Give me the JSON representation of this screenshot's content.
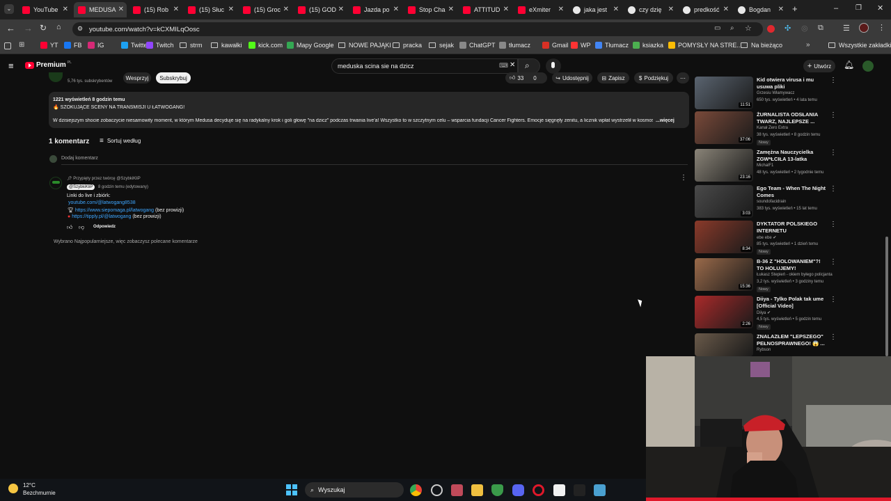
{
  "browser": {
    "tabs": [
      {
        "label": "YouTube"
      },
      {
        "label": "MEDUSA"
      },
      {
        "label": "(15) Rob"
      },
      {
        "label": "(15) Słuc"
      },
      {
        "label": "(15) Groc"
      },
      {
        "label": "(15) GOD"
      },
      {
        "label": "Jazda po"
      },
      {
        "label": "Stop Cha"
      },
      {
        "label": "ATTITUD"
      },
      {
        "label": "eXmiter"
      },
      {
        "label": "jaka jest"
      },
      {
        "label": "czy dzię"
      },
      {
        "label": "predkość"
      },
      {
        "label": "Bogdan"
      }
    ],
    "new_tab": "+",
    "url": "youtube.com/watch?v=kCXMILqOosc",
    "bookmarks": [
      {
        "label": "YT"
      },
      {
        "label": "FB"
      },
      {
        "label": "IG"
      },
      {
        "label": "Twitter"
      },
      {
        "label": "Twitch"
      },
      {
        "label": "strm"
      },
      {
        "label": "kawałki"
      },
      {
        "label": "kick.com"
      },
      {
        "label": "Mapy Google"
      },
      {
        "label": "NOWE PAJĄKI"
      },
      {
        "label": "pracka"
      },
      {
        "label": "sejak"
      },
      {
        "label": "ChatGPT"
      },
      {
        "label": "tłumacz"
      },
      {
        "label": "Gmail"
      },
      {
        "label": "WP"
      },
      {
        "label": "Tłumacz"
      },
      {
        "label": "ksiazka"
      },
      {
        "label": "POMYSŁY NA STRE..."
      },
      {
        "label": "Na bieżąco"
      }
    ],
    "all_bookmarks": "Wszystkie zakładki"
  },
  "yt_header": {
    "logo": "Premium",
    "logo_sup": "PL",
    "search_value": "meduska scina sie na dzicz",
    "create": "Utwórz"
  },
  "channel": {
    "subs": "5,76 tys. subskrybentów",
    "support": "Wesprzyj",
    "subscribe": "Subskrybuj",
    "likes": "33",
    "dislikes": "0",
    "share": "Udostępnij",
    "save": "Zapisz",
    "thanks": "Podziękuj"
  },
  "description": {
    "stats": "1221 wyświetleń  8 godzin temu",
    "headline": "🔥 SZOKUJĄCE SCENY NA TRANSMISJI U ŁATWOGANG!",
    "text": "W dzisiejszym shocie zobaczycie niesamowity moment, w którym Medusa decyduje się na radykalny krok i goli głowę \"na dzicz\" podczas trwania live'a! Wszystko to w szczytnym celu – wsparcia fundacji Cancer Fighters. Emocje sięgnęły zenitu, a licznik wpłat wystrzelił w kosmos!",
    "more": "...więcej"
  },
  "comments": {
    "count": "1 komentarz",
    "sort": "Sortuj według",
    "add": "Dodaj komentarz",
    "pinned": "Przypięty przez twórcę @SzybkiKliP",
    "author": "@SzybkiKliP",
    "time": "8 godzin temu (edytowany)",
    "line1": "Linki do live i zbiórk:",
    "link1": "youtube.com/@latwogang8538",
    "link2": "https://www.siepomaga.pl/latwogang",
    "link2_suffix": "(bez prowizji)",
    "link3": "https://tipply.pl/@latwogang",
    "link3_suffix": "(bez prowizji)",
    "reply": "Odpowiedz",
    "footer": "Wybrano Najpopularniejsze, więc zobaczysz polecane komentarze"
  },
  "sidebar": {
    "videos": [
      {
        "title": "Kid otwiera virusa i mu usuwa pliki",
        "channel": "Grzesiu Włamywacz",
        "meta": "650 tys. wyświetleń • 4 lata temu",
        "duration": "11:51",
        "new": "",
        "color": "#5a6470"
      },
      {
        "title": "ŻURNALISTA ODSŁANIA TWARZ, NAJLEPSZE ...",
        "channel": "Kanał Zero Extra",
        "meta": "38 tys. wyświetleń • 8 godzin temu",
        "duration": "37:06",
        "new": "Nowy",
        "color": "#7a4a3a"
      },
      {
        "title": "Zamężna Nauczycielka ZGW*ŁCIŁA 13-latka",
        "channel": "MichalF1",
        "meta": "48 tys. wyświetleń • 2 tygodnie temu",
        "duration": "23:16",
        "new": "",
        "color": "#8a8478"
      },
      {
        "title": "Ego Team - When The Night Comes",
        "channel": "soundofacidrain",
        "meta": "383 tys. wyświetleń • 15 lat temu",
        "duration": "3:03",
        "new": "",
        "color": "#4a4a4a"
      },
      {
        "title": "DYKTATOR POLSKIEGO INTERNETU",
        "channel": "ebe ebe ✔",
        "meta": "85 tys. wyświetleń • 1 dzień temu",
        "duration": "8:34",
        "new": "Nowy",
        "color": "#8a3a2a"
      },
      {
        "title": "B-36 Z \"HOLOWANIEM\"?! TO HOLUJEMY!",
        "channel": "Łukasz Stepień - okiem byłego policjanta",
        "meta": "3,2 tys. wyświetleń • 3 godziny temu",
        "duration": "15:36",
        "new": "Nowy",
        "color": "#9a6a4a"
      },
      {
        "title": "Diiya - Tylko Polak tak ume [Official Video]",
        "channel": "Diiya ✔",
        "meta": "4,5 tys. wyświetleń • 5 godzin temu",
        "duration": "2:26",
        "new": "Nowy",
        "color": "#aa2a2a"
      },
      {
        "title": "ZNALAZŁEM \"LEPSZEGO\" PEŁNOSPRAWNEGO! 😱 ...",
        "channel": "Rybson",
        "meta": "",
        "duration": "",
        "new": "",
        "color": "#6a5a4a"
      }
    ]
  },
  "taskbar": {
    "weather_temp": "12°C",
    "weather_desc": "Bezchmurnie",
    "search": "Wyszukaj"
  }
}
